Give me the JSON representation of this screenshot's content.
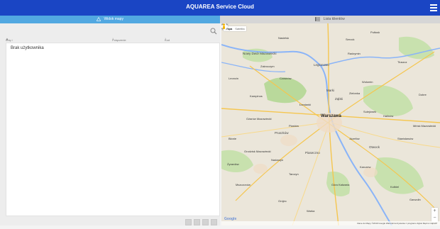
{
  "app": {
    "title": "AQUAREA Service Cloud"
  },
  "tabs": [
    {
      "label": "Widok mapy",
      "icon": "warning-icon"
    },
    {
      "label": "Lista klientów",
      "icon": "list-icon"
    }
  ],
  "table": {
    "columns": [
      "Imię i nazwisko klienta",
      "Połączenie",
      "Kod błędu"
    ],
    "empty_text": "Brak użytkownika"
  },
  "map": {
    "type_buttons": [
      "Mapa",
      "Satelita"
    ],
    "labels": [
      {
        "text": "Warszawa",
        "size": "big"
      },
      {
        "text": "Nowy Dwór Mazowiecki",
        "size": "med"
      },
      {
        "text": "Legionowo",
        "size": "med"
      },
      {
        "text": "Marki",
        "size": "med"
      },
      {
        "text": "Ząbki",
        "size": "med"
      },
      {
        "text": "Zielonka",
        "size": "small"
      },
      {
        "text": "Pruszków",
        "size": "med"
      },
      {
        "text": "Piastów",
        "size": "small"
      },
      {
        "text": "Ożarów Mazowiecki",
        "size": "small"
      },
      {
        "text": "Grodzisk Mazowiecki",
        "size": "small"
      },
      {
        "text": "Piaseczno",
        "size": "med"
      },
      {
        "text": "Józefów",
        "size": "small"
      },
      {
        "text": "Otwock",
        "size": "med"
      },
      {
        "text": "Wołomin",
        "size": "small"
      },
      {
        "text": "Radzymin",
        "size": "small"
      },
      {
        "text": "Tłuszcz",
        "size": "small"
      },
      {
        "text": "Sulejówek",
        "size": "small"
      },
      {
        "text": "Halinów",
        "size": "small"
      },
      {
        "text": "Mińsk Mazowiecki",
        "size": "small"
      },
      {
        "text": "Żyrardów",
        "size": "small"
      },
      {
        "text": "Nadarzyn",
        "size": "small"
      },
      {
        "text": "Mszczonów",
        "size": "small"
      },
      {
        "text": "Tarczyn",
        "size": "small"
      },
      {
        "text": "Góra Kalwaria",
        "size": "small"
      },
      {
        "text": "Karczew",
        "size": "small"
      },
      {
        "text": "Garwolin",
        "size": "small"
      },
      {
        "text": "Grójec",
        "size": "small"
      },
      {
        "text": "Warka",
        "size": "small"
      },
      {
        "text": "Błonie",
        "size": "small"
      },
      {
        "text": "Łomianki",
        "size": "small"
      },
      {
        "text": "Serock",
        "size": "small"
      },
      {
        "text": "Pułtusk",
        "size": "small"
      },
      {
        "text": "Nasielsk",
        "size": "small"
      },
      {
        "text": "Zakroczym",
        "size": "small"
      },
      {
        "text": "Czosnów",
        "size": "small"
      },
      {
        "text": "Kampinos",
        "size": "small"
      },
      {
        "text": "Leoncin",
        "size": "small"
      },
      {
        "text": "Stanisławów",
        "size": "small"
      },
      {
        "text": "Dobre",
        "size": "small"
      },
      {
        "text": "Kołbiel",
        "size": "small"
      }
    ],
    "attribution": "Dane do Mapy ©2019 Google   Warunki korzystania z programu   Zgłoś błąd w mapach"
  },
  "colors": {
    "topbar": "#1a45c4",
    "active_tab": "#52a8e1",
    "map_land": "#e8e3d6",
    "forest": "#b9d99b",
    "water": "#8ab4f8",
    "road_major": "#f5c64f"
  }
}
